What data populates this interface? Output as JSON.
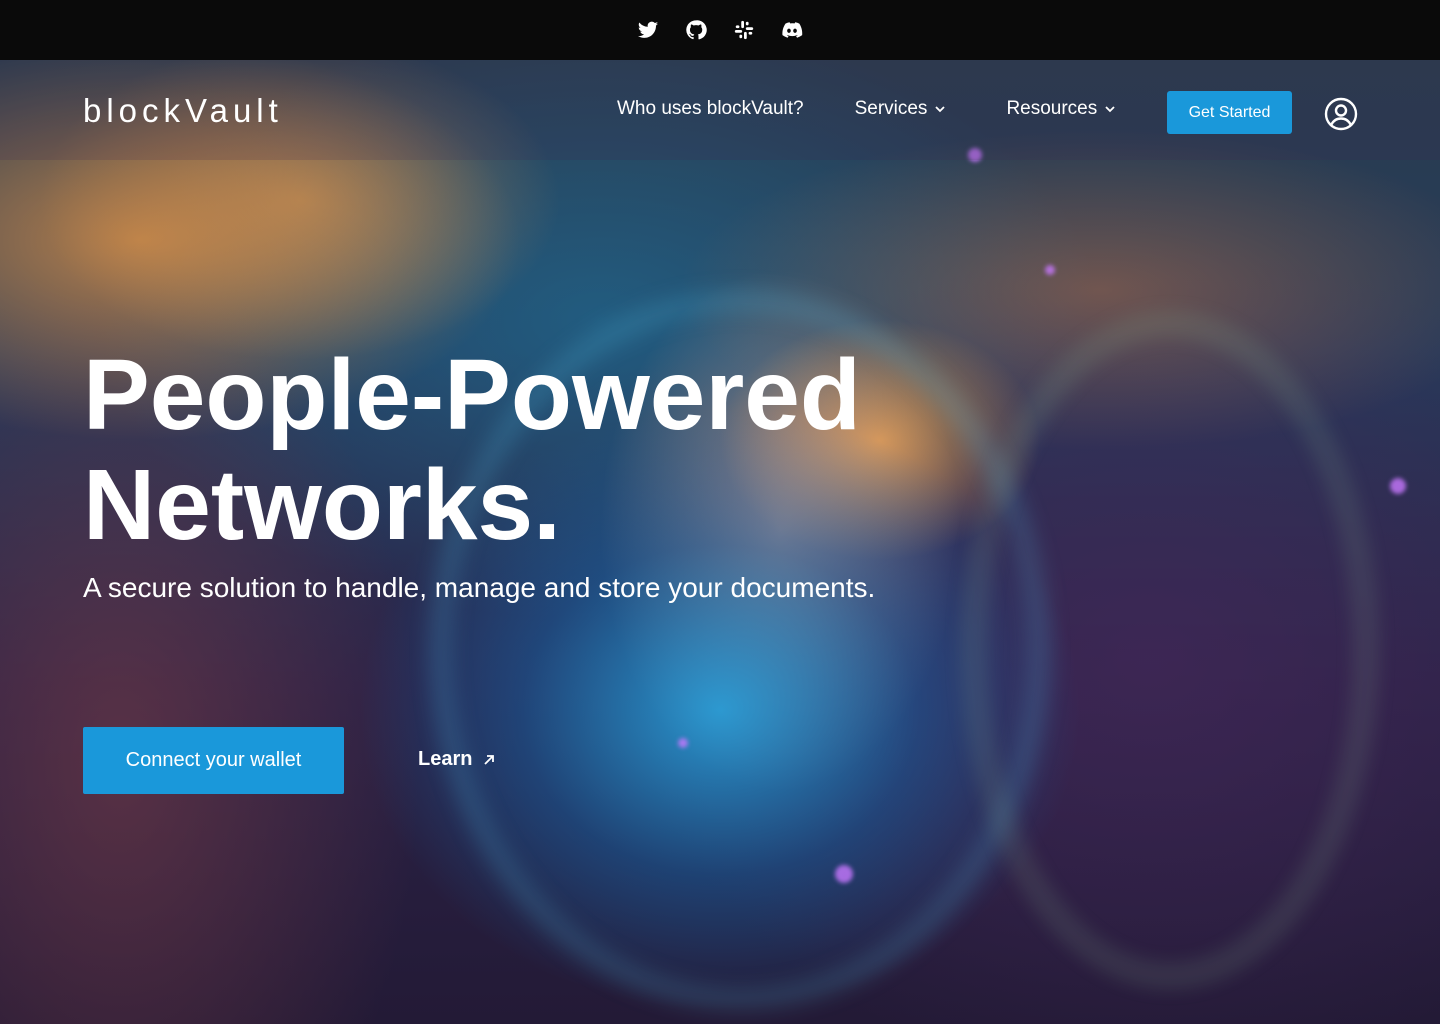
{
  "social": {
    "icons": [
      "twitter-icon",
      "github-icon",
      "slack-icon",
      "discord-icon"
    ]
  },
  "brand": {
    "name": "blockVault",
    "accent_color": "#1a98da"
  },
  "nav": {
    "who_uses": "Who uses blockVault?",
    "services": "Services",
    "resources": "Resources",
    "cta": "Get Started"
  },
  "hero": {
    "headline_line1": "People-Powered",
    "headline_line2": "Networks.",
    "subheadline": "A secure solution to handle, manage and store your documents.",
    "primary_button": "Connect your wallet",
    "secondary_link": "Learn"
  }
}
